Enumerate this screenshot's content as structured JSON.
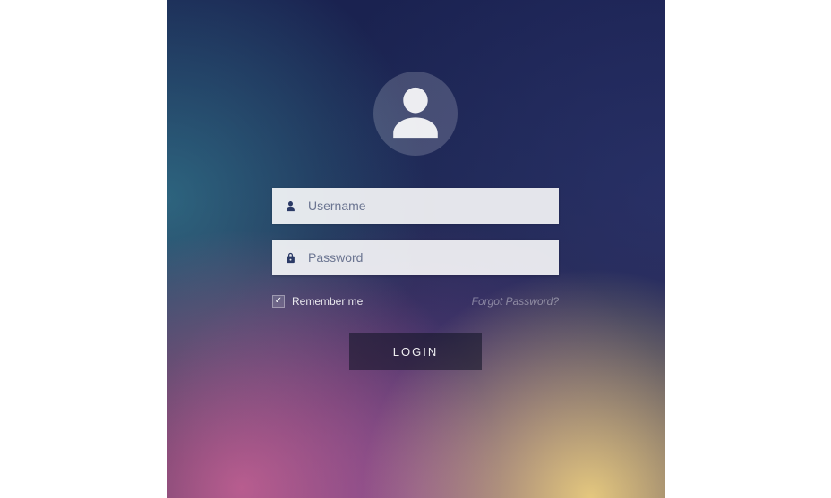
{
  "form": {
    "username_placeholder": "Username",
    "password_placeholder": "Password",
    "remember_label": "Remember me",
    "remember_checked": true,
    "forgot_label": "Forgot Password?",
    "login_label": "LOGIN"
  }
}
